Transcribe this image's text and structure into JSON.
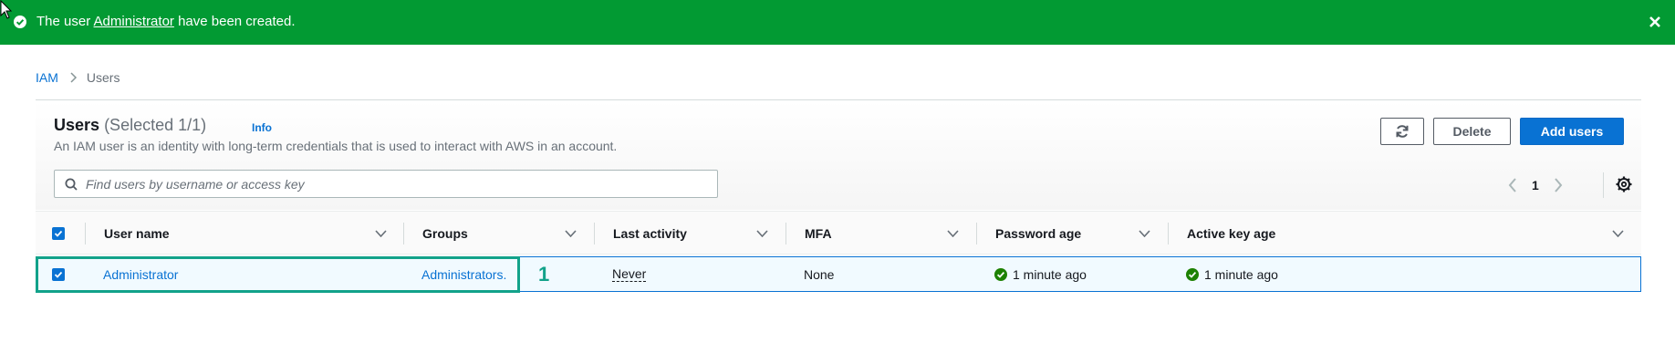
{
  "flash": {
    "prefix": "The user ",
    "user_link": "Administrator",
    "suffix": " have been created.",
    "color": "#029a33"
  },
  "breadcrumb": {
    "root": "IAM",
    "current": "Users"
  },
  "users_panel": {
    "title": "Users",
    "counter": "(Selected 1/1)",
    "info_label": "Info",
    "description": "An IAM user is an identity with long-term credentials that is used to interact with AWS in an account.",
    "buttons": {
      "refresh_icon": "refresh-icon",
      "delete_label": "Delete",
      "add_label": "Add users"
    },
    "search": {
      "placeholder": "Find users by username or access key",
      "value": ""
    },
    "pagination": {
      "current_page": "1"
    },
    "columns": [
      "User name",
      "Groups",
      "Last activity",
      "MFA",
      "Password age",
      "Active key age"
    ],
    "rows": [
      {
        "selected": true,
        "user_name": "Administrator",
        "groups": "Administrators.",
        "last_activity": "Never",
        "mfa": "None",
        "password_age": "1 minute ago",
        "active_key_age": "1 minute ago"
      }
    ],
    "annotation_label": "1"
  },
  "colors": {
    "primary": "#0972d3",
    "success": "#1d8102",
    "annotation": "#12a28a",
    "banner": "#029a33"
  }
}
